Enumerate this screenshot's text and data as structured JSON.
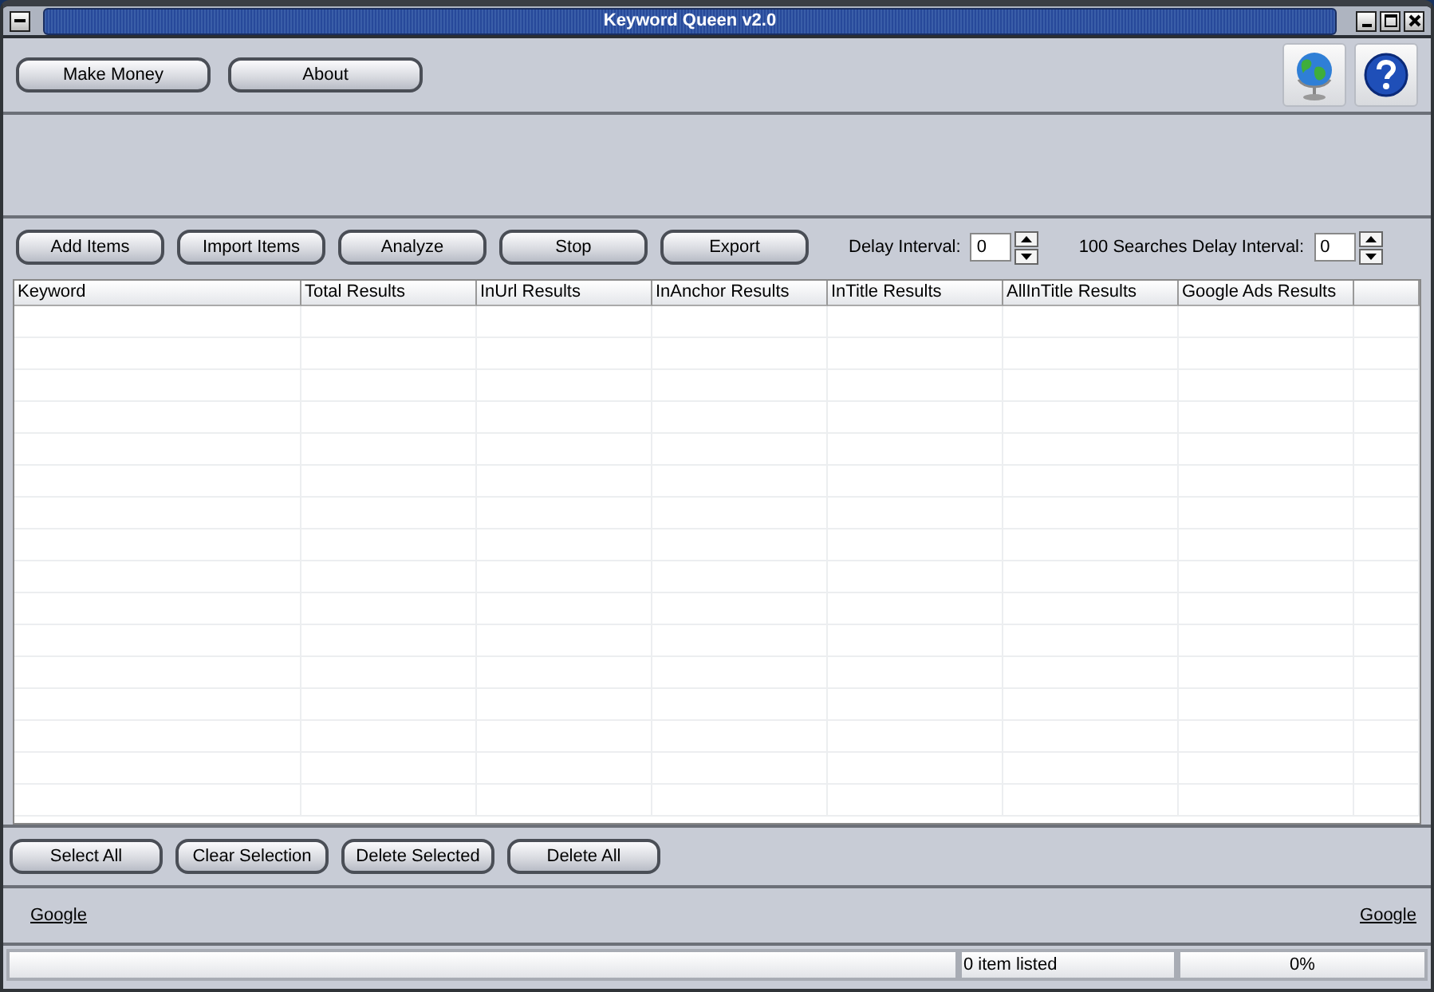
{
  "window": {
    "title": "Keyword Queen v2.0"
  },
  "top_buttons": [
    "Make Money",
    "About"
  ],
  "toolbar_buttons": [
    "Add Items",
    "Import Items",
    "Analyze",
    "Stop",
    "Export"
  ],
  "spinners": [
    {
      "label": "Delay Interval:",
      "value": "0"
    },
    {
      "label": "100 Searches Delay Interval:",
      "value": "0"
    }
  ],
  "table": {
    "columns": [
      "Keyword",
      "Total Results",
      "InUrl Results",
      "InAnchor Results",
      "InTitle Results",
      "AllInTitle Results",
      "Google Ads Results"
    ]
  },
  "bottom_buttons": [
    "Select All",
    "Clear Selection",
    "Delete Selected",
    "Delete All"
  ],
  "links": [
    "Google",
    "Google"
  ],
  "status_bar": {
    "count": "0 item listed",
    "progress": "0%"
  }
}
